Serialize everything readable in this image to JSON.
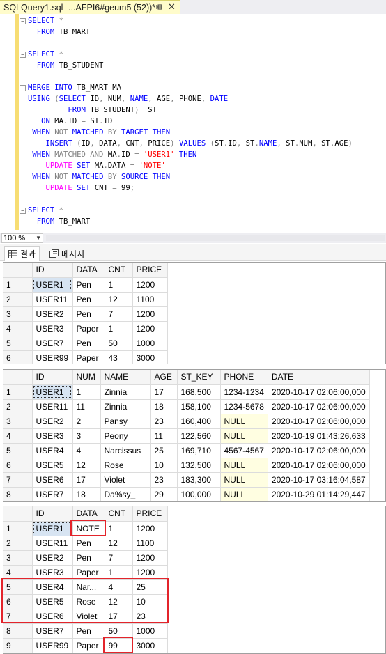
{
  "tab": {
    "title": "SQLQuery1.sql -...AFPI6#geum5 (52))*",
    "pin_icon": "pin-icon",
    "close_label": "✕"
  },
  "zoom": {
    "value": "100 %"
  },
  "results_tabs": [
    {
      "label": "결과",
      "icon": "grid-icon",
      "active": true
    },
    {
      "label": "메시지",
      "icon": "messages-icon",
      "active": false
    }
  ],
  "editor": {
    "lines": [
      [
        [
          "kw",
          "SELECT "
        ],
        [
          "gr",
          "*"
        ]
      ],
      [
        [
          "tx",
          "  "
        ],
        [
          "kw",
          "FROM "
        ],
        [
          "tx",
          "TB_MART"
        ]
      ],
      [],
      [
        [
          "kw",
          "SELECT "
        ],
        [
          "gr",
          "*"
        ]
      ],
      [
        [
          "tx",
          "  "
        ],
        [
          "kw",
          "FROM "
        ],
        [
          "tx",
          "TB_STUDENT"
        ]
      ],
      [],
      [
        [
          "kw",
          "MERGE INTO "
        ],
        [
          "tx",
          "TB_MART MA"
        ]
      ],
      [
        [
          "kw",
          "USING "
        ],
        [
          "gr",
          "("
        ],
        [
          "kw",
          "SELECT "
        ],
        [
          "tx",
          "ID"
        ],
        [
          "gr",
          ", "
        ],
        [
          "tx",
          "NUM"
        ],
        [
          "gr",
          ", "
        ],
        [
          "kw",
          "NAME"
        ],
        [
          "gr",
          ", "
        ],
        [
          "tx",
          "AGE"
        ],
        [
          "gr",
          ", "
        ],
        [
          "tx",
          "PHONE"
        ],
        [
          "gr",
          ", "
        ],
        [
          "kw",
          "DATE"
        ]
      ],
      [
        [
          "tx",
          "         "
        ],
        [
          "kw",
          "FROM "
        ],
        [
          "tx",
          "TB_STUDENT"
        ],
        [
          "gr",
          ")"
        ],
        [
          "tx",
          "  ST"
        ]
      ],
      [
        [
          "tx",
          "   "
        ],
        [
          "kw",
          "ON "
        ],
        [
          "tx",
          "MA"
        ],
        [
          "gr",
          "."
        ],
        [
          "tx",
          "ID "
        ],
        [
          "gr",
          "= "
        ],
        [
          "tx",
          "ST"
        ],
        [
          "gr",
          "."
        ],
        [
          "tx",
          "ID"
        ]
      ],
      [
        [
          "tx",
          " "
        ],
        [
          "kw",
          "WHEN "
        ],
        [
          "gr",
          "NOT "
        ],
        [
          "kw",
          "MATCHED "
        ],
        [
          "gr",
          "BY "
        ],
        [
          "kw",
          "TARGET THEN"
        ]
      ],
      [
        [
          "tx",
          "    "
        ],
        [
          "kw",
          "INSERT "
        ],
        [
          "gr",
          "("
        ],
        [
          "tx",
          "ID"
        ],
        [
          "gr",
          ", "
        ],
        [
          "tx",
          "DATA"
        ],
        [
          "gr",
          ", "
        ],
        [
          "tx",
          "CNT"
        ],
        [
          "gr",
          ", "
        ],
        [
          "tx",
          "PRICE"
        ],
        [
          "gr",
          ") "
        ],
        [
          "kw",
          "VALUES "
        ],
        [
          "gr",
          "("
        ],
        [
          "tx",
          "ST"
        ],
        [
          "gr",
          "."
        ],
        [
          "tx",
          "ID"
        ],
        [
          "gr",
          ", "
        ],
        [
          "tx",
          "ST"
        ],
        [
          "gr",
          "."
        ],
        [
          "kw",
          "NAME"
        ],
        [
          "gr",
          ", "
        ],
        [
          "tx",
          "ST"
        ],
        [
          "gr",
          "."
        ],
        [
          "tx",
          "NUM"
        ],
        [
          "gr",
          ", "
        ],
        [
          "tx",
          "ST"
        ],
        [
          "gr",
          "."
        ],
        [
          "tx",
          "AGE"
        ],
        [
          "gr",
          ")"
        ]
      ],
      [
        [
          "tx",
          " "
        ],
        [
          "kw",
          "WHEN "
        ],
        [
          "gr",
          "MATCHED AND "
        ],
        [
          "tx",
          "MA"
        ],
        [
          "gr",
          "."
        ],
        [
          "tx",
          "ID "
        ],
        [
          "gr",
          "= "
        ],
        [
          "st",
          "'USER1' "
        ],
        [
          "kw",
          "THEN"
        ]
      ],
      [
        [
          "tx",
          "    "
        ],
        [
          "pk",
          "UPDATE "
        ],
        [
          "kw",
          "SET "
        ],
        [
          "tx",
          "MA"
        ],
        [
          "gr",
          "."
        ],
        [
          "tx",
          "DATA "
        ],
        [
          "gr",
          "= "
        ],
        [
          "st",
          "'NOTE'"
        ]
      ],
      [
        [
          "tx",
          " "
        ],
        [
          "kw",
          "WHEN "
        ],
        [
          "gr",
          "NOT "
        ],
        [
          "kw",
          "MATCHED "
        ],
        [
          "gr",
          "BY "
        ],
        [
          "kw",
          "SOURCE THEN"
        ]
      ],
      [
        [
          "tx",
          "    "
        ],
        [
          "pk",
          "UPDATE "
        ],
        [
          "kw",
          "SET "
        ],
        [
          "tx",
          "CNT "
        ],
        [
          "gr",
          "= "
        ],
        [
          "tx",
          "99"
        ],
        [
          "gr",
          ";"
        ]
      ],
      [],
      [
        [
          "kw",
          "SELECT "
        ],
        [
          "gr",
          "*"
        ]
      ],
      [
        [
          "tx",
          "  "
        ],
        [
          "kw",
          "FROM "
        ],
        [
          "tx",
          "TB_MART"
        ]
      ]
    ]
  },
  "grid1": {
    "columns": [
      "ID",
      "DATA",
      "CNT",
      "PRICE"
    ],
    "rows": [
      [
        "1",
        "USER1",
        "Pen",
        "1",
        "1200"
      ],
      [
        "2",
        "USER11",
        "Pen",
        "12",
        "1100"
      ],
      [
        "3",
        "USER2",
        "Pen",
        "7",
        "1200"
      ],
      [
        "4",
        "USER3",
        "Paper",
        "1",
        "1200"
      ],
      [
        "5",
        "USER7",
        "Pen",
        "50",
        "1000"
      ],
      [
        "6",
        "USER99",
        "Paper",
        "43",
        "3000"
      ]
    ]
  },
  "grid2": {
    "columns": [
      "ID",
      "NUM",
      "NAME",
      "AGE",
      "ST_KEY",
      "PHONE",
      "DATE"
    ],
    "rows": [
      [
        "1",
        "USER1",
        "1",
        "Zinnia",
        "17",
        "168,500",
        "1234-1234",
        "2020-10-17 02:06:00,000"
      ],
      [
        "2",
        "USER11",
        "11",
        "Zinnia",
        "18",
        "158,100",
        "1234-5678",
        "2020-10-17 02:06:00,000"
      ],
      [
        "3",
        "USER2",
        "2",
        "Pansy",
        "23",
        "160,400",
        "NULL",
        "2020-10-17 02:06:00,000"
      ],
      [
        "4",
        "USER3",
        "3",
        "Peony",
        "11",
        "122,560",
        "NULL",
        "2020-10-19 01:43:26,633"
      ],
      [
        "5",
        "USER4",
        "4",
        "Narcissus",
        "25",
        "169,710",
        "4567-4567",
        "2020-10-17 02:06:00,000"
      ],
      [
        "6",
        "USER5",
        "12",
        "Rose",
        "10",
        "132,500",
        "NULL",
        "2020-10-17 02:06:00,000"
      ],
      [
        "7",
        "USER6",
        "17",
        "Violet",
        "23",
        "183,300",
        "NULL",
        "2020-10-17 03:16:04,587"
      ],
      [
        "8",
        "USER7",
        "18",
        "Da%sy_",
        "29",
        "100,000",
        "NULL",
        "2020-10-29 01:14:29,447"
      ]
    ]
  },
  "grid3": {
    "columns": [
      "ID",
      "DATA",
      "CNT",
      "PRICE"
    ],
    "rows": [
      [
        "1",
        "USER1",
        "NOTE",
        "1",
        "1200"
      ],
      [
        "2",
        "USER11",
        "Pen",
        "12",
        "1100"
      ],
      [
        "3",
        "USER2",
        "Pen",
        "7",
        "1200"
      ],
      [
        "4",
        "USER3",
        "Paper",
        "1",
        "1200"
      ],
      [
        "5",
        "USER4",
        "Nar...",
        "4",
        "25"
      ],
      [
        "6",
        "USER5",
        "Rose",
        "12",
        "10"
      ],
      [
        "7",
        "USER6",
        "Violet",
        "17",
        "23"
      ],
      [
        "8",
        "USER7",
        "Pen",
        "50",
        "1000"
      ],
      [
        "9",
        "USER99",
        "Paper",
        "99",
        "3000"
      ]
    ]
  },
  "colors": {
    "keyword": "#0000ff",
    "operator": "#808080",
    "function": "#ff00ff",
    "string": "#ff0000",
    "highlight": "#e3242b",
    "null_bg": "#fffee1"
  }
}
